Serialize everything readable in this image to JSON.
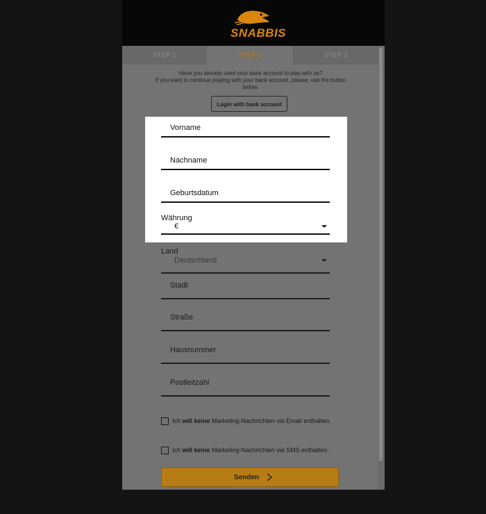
{
  "brand": {
    "name": "SNABBIS",
    "accent_color": "#d8860f",
    "logo_icon": "bird-icon"
  },
  "tabs": [
    {
      "label": "STEP 1",
      "active": false
    },
    {
      "label": "STEP 2",
      "active": true
    },
    {
      "label": "STEP 3",
      "active": false
    }
  ],
  "intro": {
    "line1": "Have you already used your bank account to play with us?",
    "line2": "If you want to continue playing with your bank account, please, use the button below."
  },
  "login_button": {
    "label": "Login with bank account"
  },
  "form": {
    "first_name": {
      "label": "Vorname",
      "value": ""
    },
    "last_name": {
      "label": "Nachname",
      "value": ""
    },
    "birth_date": {
      "label": "Geburtsdatum",
      "value": ""
    },
    "currency": {
      "label": "Währung",
      "value": "€"
    },
    "country": {
      "label": "Land",
      "value": "Deutschland"
    },
    "city": {
      "label": "Stadt",
      "value": ""
    },
    "street": {
      "label": "Straße",
      "value": ""
    },
    "house_number": {
      "label": "Hausnummer",
      "value": ""
    },
    "postal_code": {
      "label": "Postleitzahl",
      "value": ""
    }
  },
  "checkboxes": {
    "email": {
      "prefix": "Ich ",
      "bold": "will keine",
      "suffix": " Marketing-Nachrichten via Email enthalten.",
      "checked": false
    },
    "sms": {
      "prefix": "Ich ",
      "bold": "will keine",
      "suffix": " Marketing-Nachrichten via SMS enthalten.",
      "checked": false
    }
  },
  "submit": {
    "label": "Senden",
    "icon": "chevron-right-icon",
    "color": "#b77d14"
  }
}
